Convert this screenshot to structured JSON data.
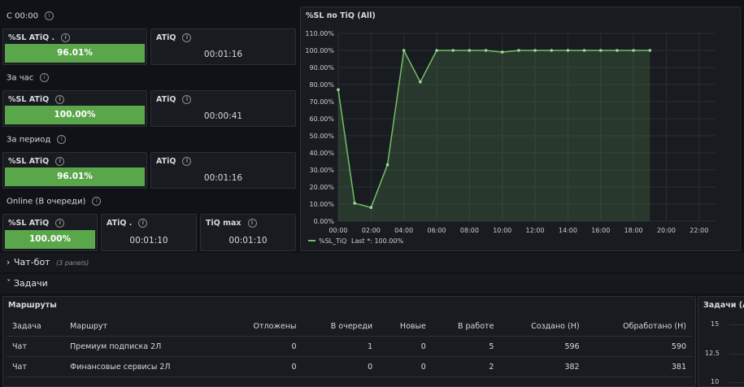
{
  "section_since_midnight": "С 00:00",
  "section_hour": "За час",
  "section_period": "За период",
  "section_online": "Online (В очереди)",
  "stat_labels": {
    "sl": "%SL ATiQ .",
    "sl2": "%SL ATiQ",
    "atiq": "ATiQ",
    "atiq_dot": "ATiQ .",
    "tiq_max": "TiQ max"
  },
  "since_midnight": {
    "sl_value": "96.01%",
    "atiq_value": "00:01:16"
  },
  "hour": {
    "sl_value": "100.00%",
    "atiq_value": "00:00:41"
  },
  "period": {
    "sl_value": "96.01%",
    "atiq_value": "00:01:16"
  },
  "online": {
    "sl_value": "100.00%",
    "atiq_value": "00:01:10",
    "tiq_max_value": "00:01:10"
  },
  "chart_panel_title": "%SL по TiQ (All)",
  "chart_data": {
    "type": "area",
    "title": "%SL по TiQ (All)",
    "x_ticks": [
      "00:00",
      "02:00",
      "04:00",
      "06:00",
      "08:00",
      "10:00",
      "12:00",
      "14:00",
      "16:00",
      "18:00",
      "20:00",
      "22:00"
    ],
    "y_ticks": [
      "0.00%",
      "10.00%",
      "20.00%",
      "30.00%",
      "40.00%",
      "50.00%",
      "60.00%",
      "70.00%",
      "80.00%",
      "90.00%",
      "100.00%",
      "110.00%"
    ],
    "ylim": [
      0,
      110
    ],
    "xlim_hours": [
      0,
      23
    ],
    "series": [
      {
        "name": "%SL_TiQ",
        "color": "#73bf69",
        "x_hours": [
          0,
          1,
          2,
          3,
          4,
          5,
          6,
          7,
          8,
          9,
          10,
          11,
          12,
          13,
          14,
          15,
          16,
          17,
          18,
          19
        ],
        "values": [
          77,
          10.5,
          8,
          33,
          100,
          81.5,
          100,
          100,
          100,
          100,
          99,
          100,
          100,
          100,
          100,
          100,
          100,
          100,
          100,
          100
        ]
      }
    ],
    "legend": {
      "name": "%SL_TiQ",
      "stat": "Last *: 100.00%",
      "position": "bottom-left"
    }
  },
  "chatbot_row": {
    "title": "Чат-бот",
    "note": "(3 panels)"
  },
  "tasks_row": {
    "title": "Задачи"
  },
  "routes_panel": {
    "title": "Маршруты",
    "columns": [
      "Задача",
      "Маршрут",
      "Отложены",
      "В очереди",
      "Новые",
      "В работе",
      "Создано (Н)",
      "Обработано (Н)"
    ],
    "rows": [
      [
        "Чат",
        "Премиум подписка 2Л",
        "0",
        "1",
        "0",
        "5",
        "596",
        "590"
      ],
      [
        "Чат",
        "Финансовые сервисы 2Л",
        "0",
        "0",
        "0",
        "2",
        "382",
        "381"
      ]
    ]
  },
  "right_panel": {
    "title": "Задачи (All",
    "y_ticks": [
      "15",
      "12.5",
      "10"
    ]
  }
}
